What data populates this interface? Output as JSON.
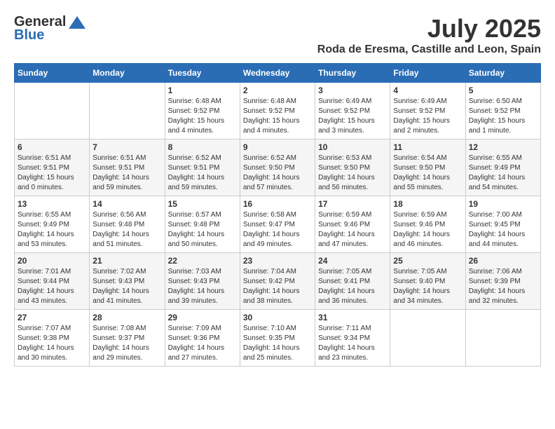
{
  "logo": {
    "general": "General",
    "blue": "Blue"
  },
  "title": "July 2025",
  "location": "Roda de Eresma, Castille and Leon, Spain",
  "days_of_week": [
    "Sunday",
    "Monday",
    "Tuesday",
    "Wednesday",
    "Thursday",
    "Friday",
    "Saturday"
  ],
  "weeks": [
    [
      {
        "day": "",
        "info": ""
      },
      {
        "day": "",
        "info": ""
      },
      {
        "day": "1",
        "info": "Sunrise: 6:48 AM\nSunset: 9:52 PM\nDaylight: 15 hours and 4 minutes."
      },
      {
        "day": "2",
        "info": "Sunrise: 6:48 AM\nSunset: 9:52 PM\nDaylight: 15 hours and 4 minutes."
      },
      {
        "day": "3",
        "info": "Sunrise: 6:49 AM\nSunset: 9:52 PM\nDaylight: 15 hours and 3 minutes."
      },
      {
        "day": "4",
        "info": "Sunrise: 6:49 AM\nSunset: 9:52 PM\nDaylight: 15 hours and 2 minutes."
      },
      {
        "day": "5",
        "info": "Sunrise: 6:50 AM\nSunset: 9:52 PM\nDaylight: 15 hours and 1 minute."
      }
    ],
    [
      {
        "day": "6",
        "info": "Sunrise: 6:51 AM\nSunset: 9:51 PM\nDaylight: 15 hours and 0 minutes."
      },
      {
        "day": "7",
        "info": "Sunrise: 6:51 AM\nSunset: 9:51 PM\nDaylight: 14 hours and 59 minutes."
      },
      {
        "day": "8",
        "info": "Sunrise: 6:52 AM\nSunset: 9:51 PM\nDaylight: 14 hours and 59 minutes."
      },
      {
        "day": "9",
        "info": "Sunrise: 6:52 AM\nSunset: 9:50 PM\nDaylight: 14 hours and 57 minutes."
      },
      {
        "day": "10",
        "info": "Sunrise: 6:53 AM\nSunset: 9:50 PM\nDaylight: 14 hours and 56 minutes."
      },
      {
        "day": "11",
        "info": "Sunrise: 6:54 AM\nSunset: 9:50 PM\nDaylight: 14 hours and 55 minutes."
      },
      {
        "day": "12",
        "info": "Sunrise: 6:55 AM\nSunset: 9:49 PM\nDaylight: 14 hours and 54 minutes."
      }
    ],
    [
      {
        "day": "13",
        "info": "Sunrise: 6:55 AM\nSunset: 9:49 PM\nDaylight: 14 hours and 53 minutes."
      },
      {
        "day": "14",
        "info": "Sunrise: 6:56 AM\nSunset: 9:48 PM\nDaylight: 14 hours and 51 minutes."
      },
      {
        "day": "15",
        "info": "Sunrise: 6:57 AM\nSunset: 9:48 PM\nDaylight: 14 hours and 50 minutes."
      },
      {
        "day": "16",
        "info": "Sunrise: 6:58 AM\nSunset: 9:47 PM\nDaylight: 14 hours and 49 minutes."
      },
      {
        "day": "17",
        "info": "Sunrise: 6:59 AM\nSunset: 9:46 PM\nDaylight: 14 hours and 47 minutes."
      },
      {
        "day": "18",
        "info": "Sunrise: 6:59 AM\nSunset: 9:46 PM\nDaylight: 14 hours and 46 minutes."
      },
      {
        "day": "19",
        "info": "Sunrise: 7:00 AM\nSunset: 9:45 PM\nDaylight: 14 hours and 44 minutes."
      }
    ],
    [
      {
        "day": "20",
        "info": "Sunrise: 7:01 AM\nSunset: 9:44 PM\nDaylight: 14 hours and 43 minutes."
      },
      {
        "day": "21",
        "info": "Sunrise: 7:02 AM\nSunset: 9:43 PM\nDaylight: 14 hours and 41 minutes."
      },
      {
        "day": "22",
        "info": "Sunrise: 7:03 AM\nSunset: 9:43 PM\nDaylight: 14 hours and 39 minutes."
      },
      {
        "day": "23",
        "info": "Sunrise: 7:04 AM\nSunset: 9:42 PM\nDaylight: 14 hours and 38 minutes."
      },
      {
        "day": "24",
        "info": "Sunrise: 7:05 AM\nSunset: 9:41 PM\nDaylight: 14 hours and 36 minutes."
      },
      {
        "day": "25",
        "info": "Sunrise: 7:05 AM\nSunset: 9:40 PM\nDaylight: 14 hours and 34 minutes."
      },
      {
        "day": "26",
        "info": "Sunrise: 7:06 AM\nSunset: 9:39 PM\nDaylight: 14 hours and 32 minutes."
      }
    ],
    [
      {
        "day": "27",
        "info": "Sunrise: 7:07 AM\nSunset: 9:38 PM\nDaylight: 14 hours and 30 minutes."
      },
      {
        "day": "28",
        "info": "Sunrise: 7:08 AM\nSunset: 9:37 PM\nDaylight: 14 hours and 29 minutes."
      },
      {
        "day": "29",
        "info": "Sunrise: 7:09 AM\nSunset: 9:36 PM\nDaylight: 14 hours and 27 minutes."
      },
      {
        "day": "30",
        "info": "Sunrise: 7:10 AM\nSunset: 9:35 PM\nDaylight: 14 hours and 25 minutes."
      },
      {
        "day": "31",
        "info": "Sunrise: 7:11 AM\nSunset: 9:34 PM\nDaylight: 14 hours and 23 minutes."
      },
      {
        "day": "",
        "info": ""
      },
      {
        "day": "",
        "info": ""
      }
    ]
  ]
}
